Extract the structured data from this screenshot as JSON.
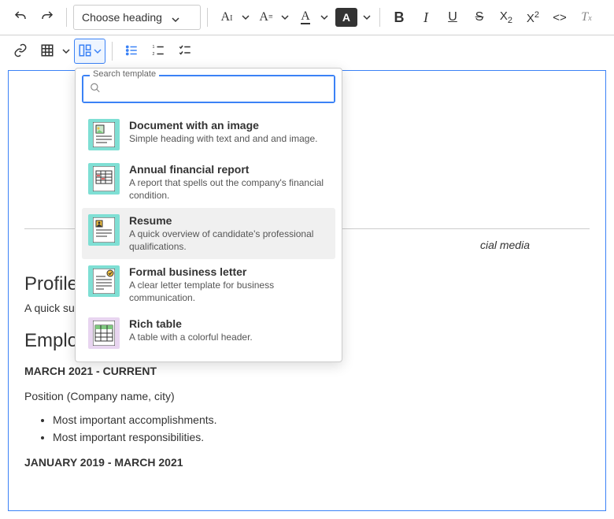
{
  "toolbar": {
    "heading_placeholder": "Choose heading"
  },
  "dropdown": {
    "search_label": "Search template",
    "templates": [
      {
        "name": "Document with an image",
        "desc": "Simple heading with text and and and image."
      },
      {
        "name": "Annual financial report",
        "desc": "A report that spells out the company's financial condition."
      },
      {
        "name": "Resume",
        "desc": "A quick overview of candidate's professional qualifications."
      },
      {
        "name": "Formal business letter",
        "desc": "A clear letter template for business communication."
      },
      {
        "name": "Rich table",
        "desc": "A table with a colorful header."
      }
    ]
  },
  "document": {
    "contact_suffix": "cial media",
    "profile_heading": "Profile",
    "profile_text_prefix": "A quick sum",
    "employment_heading": "Employment history",
    "range1": "MARCH 2021 - CURRENT",
    "position_line": "Position (Company name, city)",
    "bullets": [
      "Most important accomplishments.",
      "Most important responsibilities."
    ],
    "range2": "JANUARY 2019 - MARCH 2021"
  }
}
